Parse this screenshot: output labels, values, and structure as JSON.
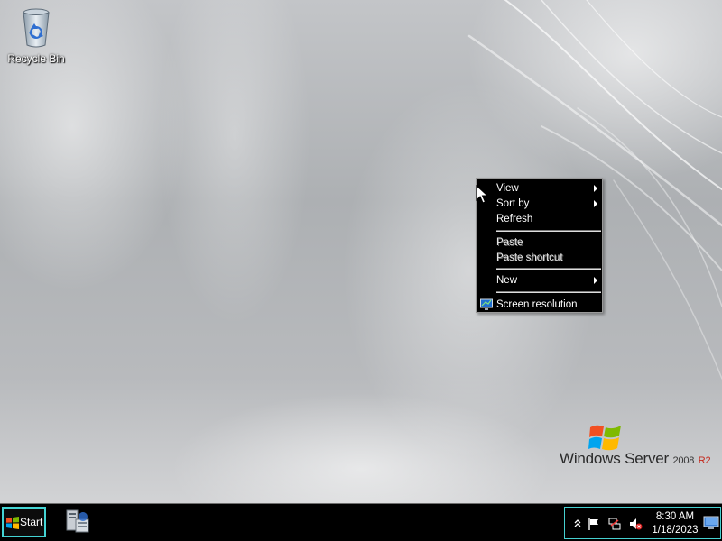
{
  "desktop": {
    "icons": [
      {
        "label": "Recycle Bin",
        "icon": "recycle-bin-icon"
      }
    ],
    "branding": {
      "name": "Windows Server",
      "version": "2008",
      "edition": "R2",
      "logo_icon": "windows-flag-icon"
    }
  },
  "context_menu": {
    "items": [
      {
        "label": "View",
        "submenu": true,
        "enabled": true
      },
      {
        "label": "Sort by",
        "submenu": true,
        "enabled": true
      },
      {
        "label": "Refresh",
        "submenu": false,
        "enabled": true
      },
      {
        "label": "Paste",
        "submenu": false,
        "enabled": false
      },
      {
        "label": "Paste shortcut",
        "submenu": false,
        "enabled": false
      },
      {
        "label": "New",
        "submenu": true,
        "enabled": true
      },
      {
        "label": "Screen resolution",
        "submenu": false,
        "enabled": true,
        "icon": "monitor-icon"
      }
    ]
  },
  "taskbar": {
    "start_label": "Start",
    "pinned": [
      {
        "icon": "server-manager-icon"
      }
    ],
    "tray": {
      "icons": [
        "show-hidden-icons-chevron",
        "action-center-flag-icon",
        "network-icon",
        "volume-muted-icon"
      ],
      "time": "8:30 AM",
      "date": "1/18/2023",
      "show_desktop_icon": "show-desktop-icon"
    }
  },
  "colors": {
    "taskbar_bg": "#000000",
    "highlight_border": "#44d4d4",
    "menu_bg": "#000000",
    "brand_r2": "#c4281c"
  }
}
